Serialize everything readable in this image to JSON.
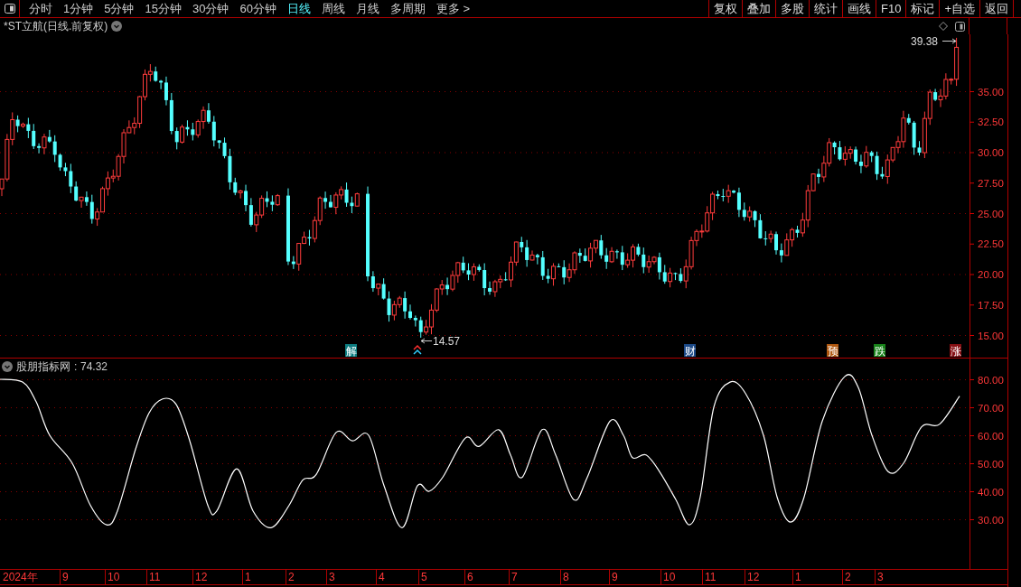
{
  "toolbar": {
    "periods": [
      {
        "label": "分时",
        "selected": false
      },
      {
        "label": "1分钟",
        "selected": false
      },
      {
        "label": "5分钟",
        "selected": false
      },
      {
        "label": "15分钟",
        "selected": false
      },
      {
        "label": "30分钟",
        "selected": false
      },
      {
        "label": "60分钟",
        "selected": false
      },
      {
        "label": "日线",
        "selected": true
      },
      {
        "label": "周线",
        "selected": false
      },
      {
        "label": "月线",
        "selected": false
      },
      {
        "label": "多周期",
        "selected": false
      },
      {
        "label": "更多 >",
        "selected": false
      }
    ],
    "actions": [
      "复权",
      "叠加",
      "多股",
      "统计",
      "画线",
      "F10",
      "标记",
      "+自选",
      "返回"
    ]
  },
  "stock": {
    "title": "*ST立航(日线.前复权)"
  },
  "price_chart": {
    "axis_labels": [
      "35.00",
      "32.50",
      "30.00",
      "27.50",
      "25.00",
      "22.50",
      "20.00",
      "17.50",
      "15.00"
    ],
    "high_label": "39.38",
    "low_label": "14.57",
    "events": [
      {
        "label": "解",
        "color": "#0c7c80"
      },
      {
        "label": "财",
        "color": "#1c4a88"
      },
      {
        "label": "预",
        "color": "#b05810"
      },
      {
        "label": "跌",
        "color": "#18821a"
      },
      {
        "label": "涨",
        "color": "#861014"
      }
    ]
  },
  "indicator": {
    "name": "股朋指标网",
    "separator": ":",
    "value": "74.32",
    "axis_labels": [
      "80.00",
      "70.00",
      "60.00",
      "50.00",
      "40.00",
      "30.00"
    ]
  },
  "timeline": [
    "2024年",
    "9",
    "10",
    "11",
    "12",
    "1",
    "2",
    "3",
    "4",
    "5",
    "6",
    "7",
    "8",
    "9",
    "10",
    "11",
    "12",
    "1",
    "2",
    "3"
  ]
}
